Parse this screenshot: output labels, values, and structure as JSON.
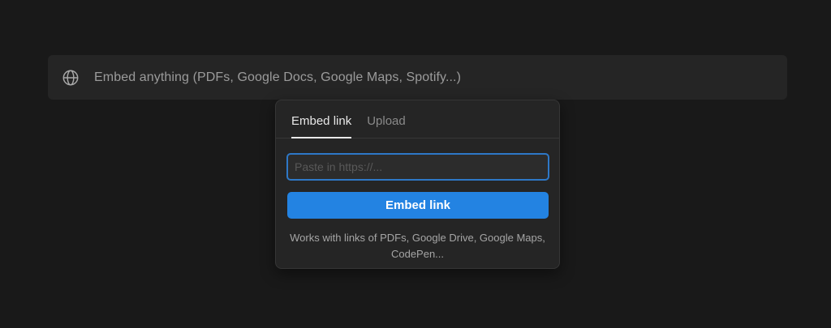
{
  "embed_block": {
    "icon": "globe-icon",
    "label": "Embed anything (PDFs, Google Docs, Google Maps, Spotify...)"
  },
  "popover": {
    "tabs": [
      {
        "label": "Embed link",
        "active": true
      },
      {
        "label": "Upload",
        "active": false
      }
    ],
    "input": {
      "placeholder": "Paste in https://...",
      "value": ""
    },
    "button_label": "Embed link",
    "hint": "Works with links of PDFs, Google Drive, Google Maps, CodePen..."
  },
  "colors": {
    "background": "#191919",
    "block_background": "#252525",
    "accent": "#2383e2",
    "input_focus_border": "#2e78c7"
  }
}
